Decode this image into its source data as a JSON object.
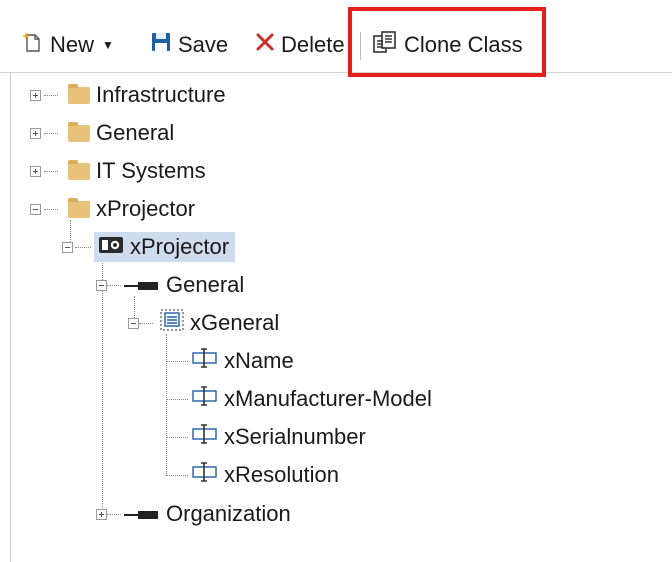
{
  "toolbar": {
    "new_label": "New",
    "save_label": "Save",
    "delete_label": "Delete",
    "clone_label": "Clone Class",
    "highlight_color": "#e5201b"
  },
  "tree": {
    "folders": [
      {
        "label": "Infrastructure",
        "icon": "folder-icon",
        "expanded": false
      },
      {
        "label": "General",
        "icon": "folder-icon",
        "expanded": false
      },
      {
        "label": "IT Systems",
        "icon": "folder-icon",
        "expanded": false
      },
      {
        "label": "xProjector",
        "icon": "folder-icon",
        "expanded": true
      }
    ],
    "class_node": {
      "label": "xProjector",
      "icon": "class-icon",
      "selected": true
    },
    "group_general": {
      "label": "General",
      "icon": "group-icon",
      "expanded": true
    },
    "section": {
      "label": "xGeneral",
      "icon": "section-icon",
      "expanded": true
    },
    "fields": [
      {
        "label": "xName",
        "icon": "field-icon"
      },
      {
        "label": "xManufacturer-Model",
        "icon": "field-icon"
      },
      {
        "label": "xSerialnumber",
        "icon": "field-icon"
      },
      {
        "label": "xResolution",
        "icon": "field-icon"
      }
    ],
    "group_org": {
      "label": "Organization",
      "icon": "group-icon",
      "expanded": false
    }
  }
}
